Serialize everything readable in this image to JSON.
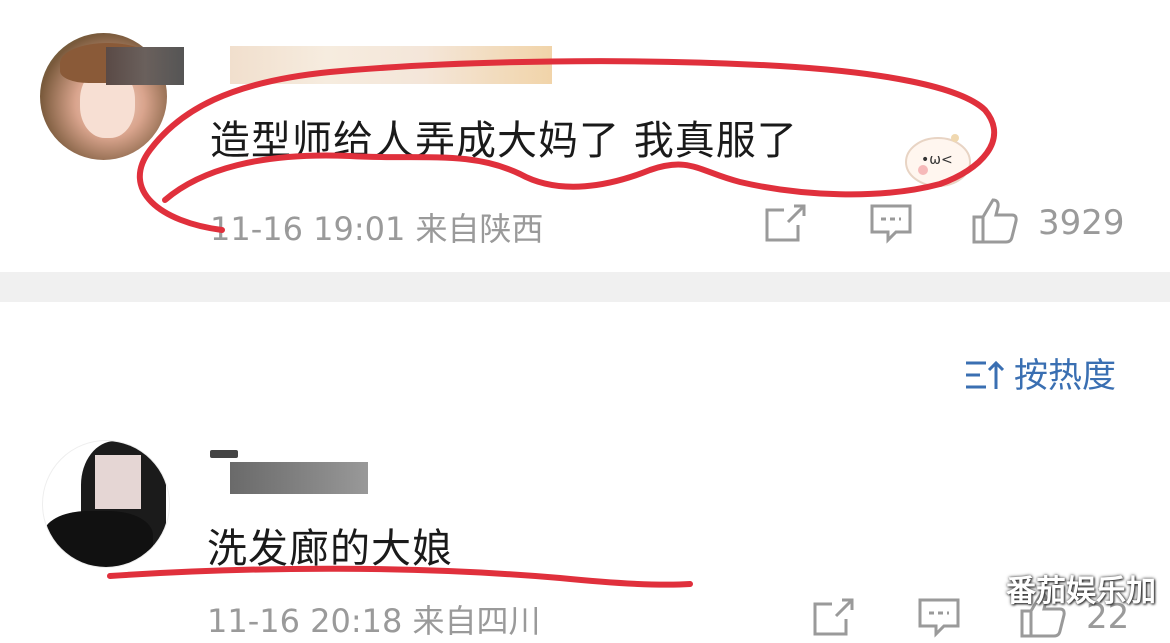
{
  "comments": [
    {
      "text": "造型师给人弄成大妈了 我真服了",
      "meta": "11-16 19:01 来自陕西",
      "likes": "3929"
    },
    {
      "text": "洗发廊的大娘",
      "meta": "11-16 20:18 来自四川",
      "likes": "22"
    }
  ],
  "sort": {
    "label": "按热度"
  },
  "watermark": "番茄娱乐加",
  "colors": {
    "highlight_red": "#e0303c",
    "link_blue": "#3a6fb2",
    "meta_gray": "#9a9a9a"
  },
  "icons": [
    "repost-icon",
    "comment-icon",
    "like-icon",
    "sort-icon"
  ]
}
